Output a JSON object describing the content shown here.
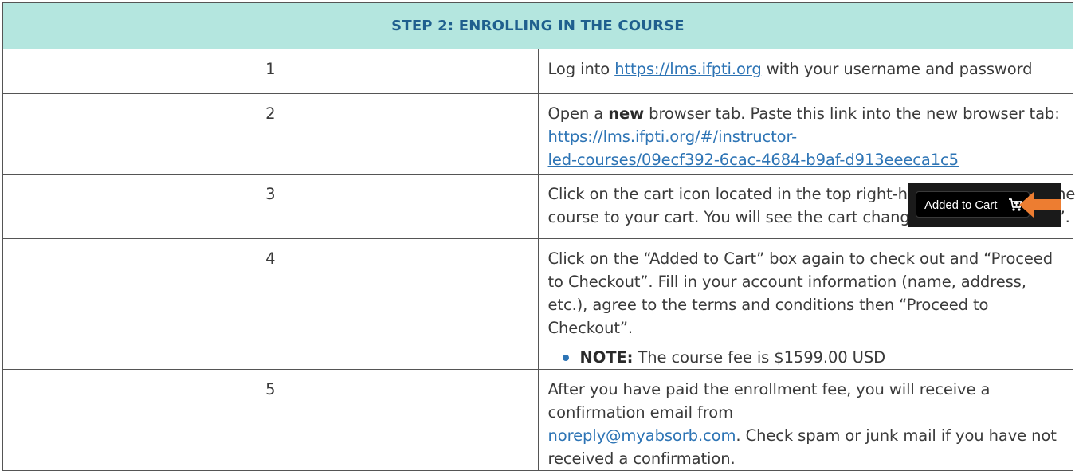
{
  "header": {
    "title": "STEP 2: ENROLLING IN THE COURSE"
  },
  "steps": [
    {
      "number": "1",
      "pre": "Log into ",
      "link": "https://lms.ifpti.org",
      "post": " with your username and password"
    },
    {
      "number": "2",
      "pre": "Open a ",
      "bold": "new",
      "mid": " browser tab. Paste this link into the new browser tab: ",
      "link_line1": "https://lms.ifpti.org/#/instructor-",
      "link_line2": "led-courses/09ecf392-6cac-4684-b9af-d913eeeca1c5"
    },
    {
      "number": "3",
      "text": "Click on the cart icon located in the top right-hand corner to add the course to your cart. You will see the cart change to “Added to Cart”.",
      "button_label": "Added to Cart"
    },
    {
      "number": "4",
      "text": "Click on the “Added to Cart” box again to check out and “Proceed to Checkout”. Fill in your account information (name, address, etc.), agree to the terms and conditions then “Proceed to Checkout”.",
      "note_label": "NOTE:",
      "note_text": " The course fee is $1599.00 USD"
    },
    {
      "number": "5",
      "text_line1": "After you have paid the enrollment fee, you will receive a confirmation email from",
      "link": "noreply@myabsorb.com",
      "post": ". Check spam or junk mail if you have not received a confirmation."
    }
  ],
  "colors": {
    "header_bg": "#b4e6df",
    "header_text": "#1f5f8e",
    "link": "#2d74b5",
    "arrow": "#ed7d31",
    "cart_bg": "#1a1a1a"
  }
}
